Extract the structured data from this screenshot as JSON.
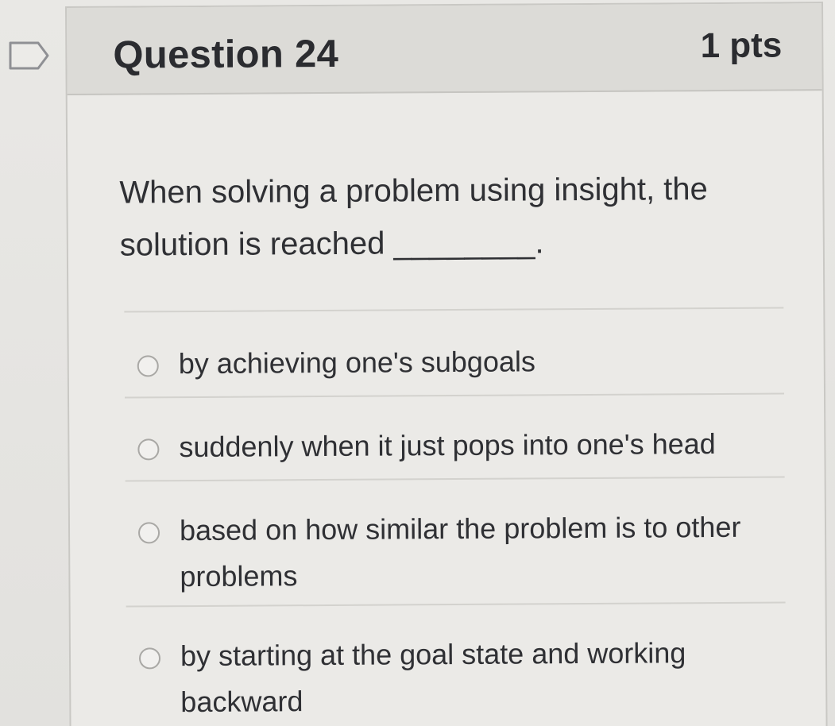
{
  "question": {
    "title": "Question 24",
    "points": "1 pts",
    "text": "When solving a problem using insight, the solution is reached ________."
  },
  "answers": [
    {
      "label": "by achieving one's subgoals",
      "selected": false
    },
    {
      "label": "suddenly when it just pops into one's head",
      "selected": false
    },
    {
      "label": "based on how similar the problem is to other problems",
      "selected": false
    },
    {
      "label": "by starting at the goal state and working backward",
      "selected": false
    }
  ],
  "icons": {
    "flag": "flag-outline-icon",
    "radio": "radio-unselected-icon"
  }
}
